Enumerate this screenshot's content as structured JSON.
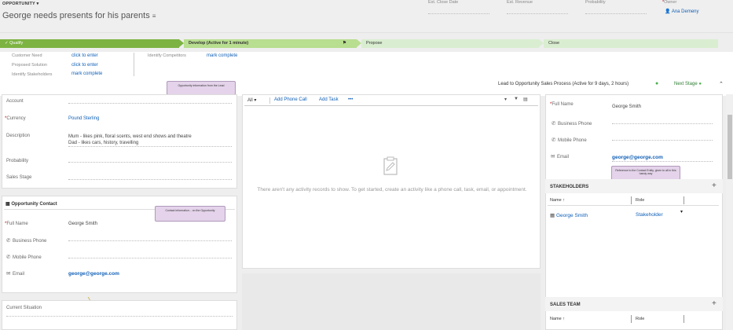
{
  "header": {
    "entity_type": "OPPORTUNITY ▾",
    "title": "George needs presents for his parents",
    "fields": [
      {
        "label": "Est. Close Date",
        "value": ""
      },
      {
        "label": "Est. Revenue",
        "value": ""
      },
      {
        "label": "Probability",
        "value": ""
      },
      {
        "label": "Owner",
        "value": "Ana Demeny"
      }
    ]
  },
  "process": {
    "stages": [
      {
        "label": "✓ Qualify"
      },
      {
        "label": "Develop (Active for 1 minute)"
      },
      {
        "label": "Propose"
      },
      {
        "label": "Close"
      }
    ],
    "steps": [
      {
        "label": "Customer Need",
        "value": "click to enter"
      },
      {
        "label": "Proposed Solution",
        "value": "click to enter"
      },
      {
        "label": "Identify Stakeholders",
        "value": "mark complete"
      }
    ],
    "competitors": {
      "label": "Identify Competitors",
      "value": "mark complete"
    },
    "summary": "Lead to Opportunity Sales Process (Active for 9 days, 2 hours)",
    "next_stage": "Next Stage"
  },
  "left": {
    "callout1": "Opportunity information from the Lead",
    "fields": [
      {
        "label": "Account",
        "value": ""
      },
      {
        "label": "Currency",
        "value": "Pound Sterling"
      },
      {
        "label": "Description",
        "value": "Mum - likes pink, floral scents, west end shows and theatre\nDad - likes cars, history, travelling"
      },
      {
        "label": "Probability",
        "value": ""
      },
      {
        "label": "Sales Stage",
        "value": ""
      }
    ],
    "contact_section": "Opportunity Contact",
    "callout2": "Contact information... on the Opportunity",
    "contact_fields": [
      {
        "label": "Full Name",
        "value": "George Smith"
      },
      {
        "label": "Business Phone",
        "value": ""
      },
      {
        "label": "Mobile Phone",
        "value": ""
      },
      {
        "label": "Email",
        "value": "george@george.com"
      }
    ],
    "current_situation": "Current Situation"
  },
  "middle": {
    "filter": "All",
    "add_phone": "Add Phone Call",
    "add_task": "Add Task",
    "more": "•••",
    "empty": "There aren't any activity records to show. To get started, create an activity like a phone call, task, email, or appointment."
  },
  "right": {
    "fields": [
      {
        "label": "Full Name",
        "value": "George Smith"
      },
      {
        "label": "Business Phone",
        "value": ""
      },
      {
        "label": "Mobile Phone",
        "value": ""
      },
      {
        "label": "Email",
        "value": "george@george.com"
      }
    ],
    "callout": "Reference to the Contact Entity, given to all in this handy way",
    "stakeholders": "STAKEHOLDERS",
    "col_name": "Name ↑",
    "col_role": "Role",
    "row_name": "George Smith",
    "row_role": "Stakeholder",
    "sales_team": "SALES TEAM",
    "st_col_name": "Name ↑",
    "st_col_role": "Role"
  }
}
